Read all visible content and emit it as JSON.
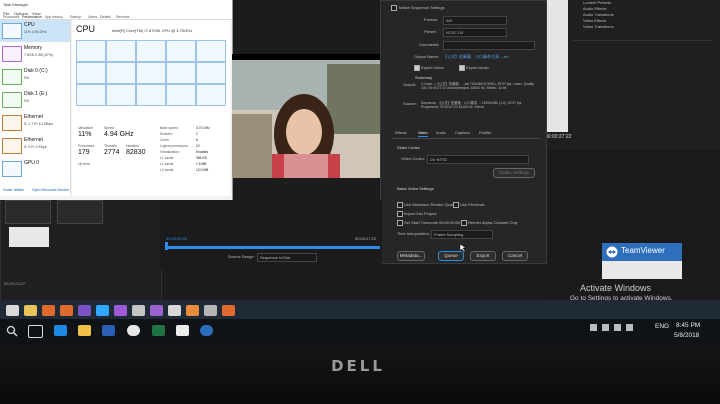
{
  "taskmanager": {
    "title": "Task Manager",
    "menu": [
      "File",
      "Options",
      "View"
    ],
    "tabs": [
      "Processes",
      "Performance",
      "App history",
      "Startup",
      "Users",
      "Details",
      "Services"
    ],
    "sidebar": [
      {
        "name": "CPU",
        "detail": "11% 4.94 GHz"
      },
      {
        "name": "Memory",
        "detail": "7.5/16.0 GB (47%)"
      },
      {
        "name": "Disk 0 (C:)",
        "detail": "0%"
      },
      {
        "name": "Disk 1 (E:)",
        "detail": "0%"
      },
      {
        "name": "Ethernet",
        "detail": "S: 1.7 R: 6.2 Mbps"
      },
      {
        "name": "Ethernet",
        "detail": "S: 0 R: 0 Kbps"
      },
      {
        "name": "GPU 0",
        "detail": ""
      }
    ],
    "cpu_heading": "CPU",
    "cpu_model": "Intel(R) Core(TM) i7-8700K CPU @ 3.70GHz",
    "utilization_label": "Utilization",
    "utilization": "11%",
    "speed_label": "Speed",
    "speed": "4.94 GHz",
    "processes_label": "Processes",
    "processes": "179",
    "threads_label": "Threads",
    "threads": "2774",
    "handles_label": "Handles",
    "handles": "82830",
    "base_speed_label": "Base speed:",
    "base_speed": "3.70 GHz",
    "sockets_label": "Sockets:",
    "sockets": "1",
    "cores_label": "Cores:",
    "cores": "6",
    "logical_label": "Logical processors:",
    "logical": "12",
    "virt_label": "Virtualization:",
    "virt": "Enabled",
    "l1_label": "L1 cache:",
    "l1": "384 KB",
    "l2_label": "L2 cache:",
    "l2": "1.5 MB",
    "l3_label": "L3 cache:",
    "l3": "12.0 MB",
    "uptime_label": "Up time",
    "fewer_details": "Fewer details",
    "open_resmon": "Open Resource Monitor"
  },
  "export": {
    "match_label": "Match Sequence Settings",
    "format_label": "Format:",
    "format_value": "AVI",
    "preset_label": "Preset:",
    "preset_value": "NTSC DV",
    "comments_label": "Comments:",
    "output_name_label": "Output Name:",
    "output_name_value": "【公式】佐藤健、川口春奈主演 ...avi",
    "export_video": "Export Video",
    "export_audio": "Export Audio",
    "summary_label": "Summary",
    "output_label": "Output:",
    "output_text": "C:\\User...\\【公式】佐藤健、...avi 720x480 (0.9091), 29.97 fps, Lower, Quality 100, 00:00:27:22 Uncompressed, 48000 Hz, Stereo, 16 bit",
    "source_label": "Source:",
    "source_text": "Sequence, 【公式】佐藤健、川口春奈 ... 1920x1080 (1.0), 29.97 fps, Progressive, 00:00:27:22 44100 Hz, Stereo",
    "tabs": [
      "Effects",
      "Video",
      "Audio",
      "Captions",
      "Publish"
    ],
    "video_codec_label": "Video Codec",
    "codec_label": "Video Codec:",
    "codec_value": "DV NTSC",
    "codec_settings": "Codec Settings",
    "basic_settings": "Basic Video Settings",
    "use_max_render": "Use Maximum Render Quality",
    "use_previews": "Use Previews",
    "import_project": "Import into Project",
    "set_start_tc": "Set Start Timecode",
    "tc_value": "00:00:00:00",
    "render_alpha": "Render Alpha Channel Only",
    "time_interp_label": "Time Interpolation:",
    "time_interp_value": "Frame Sampling",
    "metadata": "Metadata...",
    "queue": "Queue",
    "export_btn": "Export",
    "cancel": "Cancel"
  },
  "timeline": {
    "timecode_start": "00:00:00:00",
    "timecode_end": "00:00:27:22",
    "source_range_label": "Source Range:",
    "source_range_value": "Sequence In/Out",
    "clip_duration": "00;00;23;27"
  },
  "effects_panel": {
    "items": [
      "Lumetri Presets",
      "Audio Effects",
      "Audio Transitions",
      "Video Effects",
      "Video Transitions"
    ],
    "timecode": "00:00:27:22"
  },
  "taskbar": {
    "time": "8:45 PM",
    "date": "5/8/2018",
    "lang": "ENG",
    "activate_title": "Activate Windows",
    "activate_sub": "Go to Settings to activate Windows."
  },
  "teamviewer": {
    "title": "TeamViewer"
  },
  "brand": "DELL",
  "colors": {
    "premiere_bg": "#232323",
    "accent_blue": "#2d8ceb",
    "taskbar": "#1e2a36",
    "teamviewer": "#2e6fbd"
  }
}
